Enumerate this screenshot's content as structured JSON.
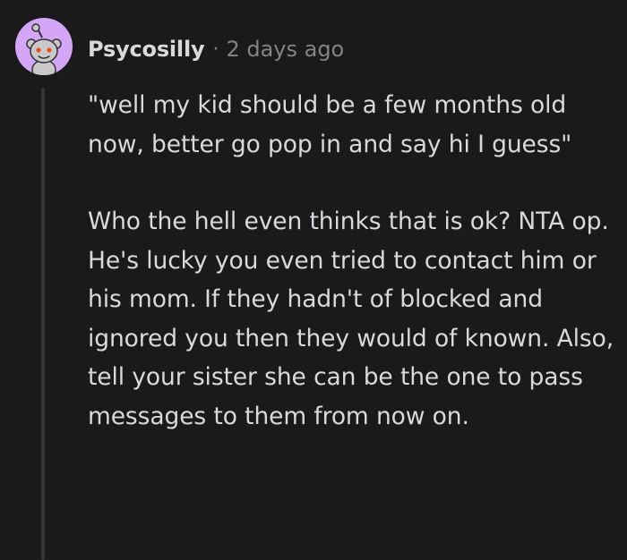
{
  "comment": {
    "username": "Psycosilly",
    "separator": "·",
    "timestamp": "2 days ago",
    "avatar_icon": "snoo-avatar-icon",
    "colors": {
      "background": "#1a1a1b",
      "avatar_bg": "#d5a6f7",
      "text": "#d7dadc",
      "meta": "#818384",
      "thread_line": "#343536"
    },
    "paragraphs": [
      "\"well my kid should be a few months old now, better go pop in and say hi I guess\"",
      "Who the hell even thinks that is ok? NTA op. He's lucky you even tried to contact him or his mom. If they hadn't of blocked and ignored you then they would of known. Also, tell your sister she can be the one to pass messages to them from now on."
    ]
  }
}
